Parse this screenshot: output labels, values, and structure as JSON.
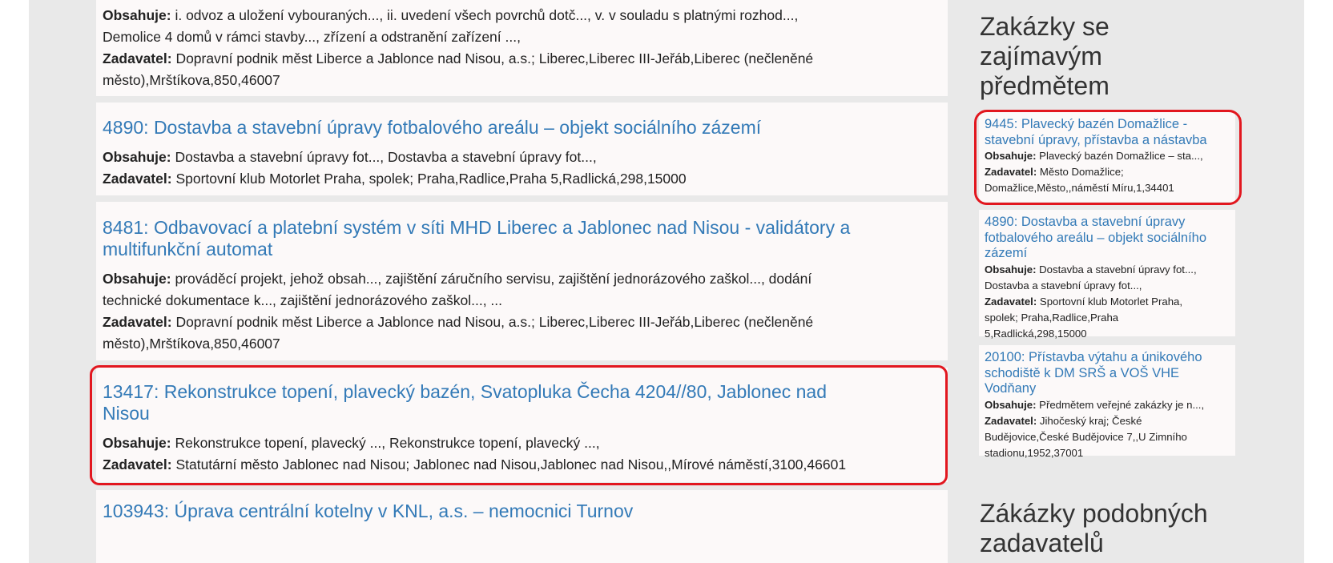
{
  "labels": {
    "obsahuje": "Obsahuje:",
    "zadavatel": "Zadavatel:"
  },
  "main": {
    "cards": [
      {
        "title": "",
        "obsahuje_lines": [
          "i. odvoz a uložení vybouraných..., ii. uvedení všech povrchů dotč..., v. v souladu s platnými rozhod...,",
          "Demolice 4 domů v rámci stavby..., zřízení a odstranění zařízení ...,"
        ],
        "zadavatel_lines": [
          "Dopravní podnik měst Liberce a Jablonce nad Nisou, a.s.; Liberec,Liberec III-Jeřáb,Liberec (nečleněné",
          "město),Mrštíkova,850,46007"
        ]
      },
      {
        "title": "4890: Dostavba a stavební úpravy fotbalového areálu – objekt sociálního zázemí",
        "obsahuje_lines": [
          "Dostavba a stavební úpravy fot..., Dostavba a stavební úpravy fot...,"
        ],
        "zadavatel_lines": [
          "Sportovní klub Motorlet Praha, spolek; Praha,Radlice,Praha 5,Radlická,298,15000"
        ]
      },
      {
        "title_lines": [
          "8481: Odbavovací a platební systém v síti MHD Liberec a Jablonec nad Nisou - validátory a",
          "multifunkční automat"
        ],
        "obsahuje_lines": [
          "prováděcí projekt, jehož obsah..., zajištění záručního servisu, zajištění jednorázového zaškol..., dodání",
          "technické dokumentace k..., zajištění jednorázového zaškol..., ..."
        ],
        "zadavatel_lines": [
          "Dopravní podnik měst Liberce a Jablonce nad Nisou, a.s.; Liberec,Liberec III-Jeřáb,Liberec (nečleněné",
          "město),Mrštíkova,850,46007"
        ]
      },
      {
        "title_lines": [
          "13417: Rekonstrukce topení, plavecký bazén, Svatopluka Čecha 4204//80, Jablonec nad",
          "Nisou"
        ],
        "obsahuje_lines": [
          "Rekonstrukce topení, plavecký ..., Rekonstrukce topení, plavecký ...,"
        ],
        "zadavatel_lines": [
          "Statutární město Jablonec nad Nisou; Jablonec nad Nisou,Jablonec nad Nisou,,Mírové náměstí,3100,46601"
        ]
      },
      {
        "title": "103943: Úprava centrální kotelny v KNL, a.s. – nemocnici Turnov"
      }
    ]
  },
  "sidebar": {
    "heading1_lines": [
      "Zakázky se",
      "zajímavým",
      "předmětem"
    ],
    "heading2_lines": [
      "Zákázky podobných",
      "zadavatelů"
    ],
    "cards": [
      {
        "title_lines": [
          "9445: Plavecký bazén Domažlice -",
          "stavební úpravy, přístavba a nástavba"
        ],
        "obsahuje": "Plavecký bazén Domažlice – sta...,",
        "zadavatel_lines": [
          "Město Domažlice;",
          "Domažlice,Město,,náměstí Míru,1,34401"
        ]
      },
      {
        "title_lines": [
          "4890: Dostavba a stavební úpravy",
          "fotbalového areálu – objekt sociálního",
          "zázemí"
        ],
        "obsahuje_lines": [
          "Dostavba a stavební úpravy fot...,",
          "Dostavba a stavební úpravy fot...,"
        ],
        "zadavatel_lines": [
          "Sportovní klub Motorlet Praha,",
          "spolek; Praha,Radlice,Praha",
          "5,Radlická,298,15000"
        ]
      },
      {
        "title_lines": [
          "20100: Přístavba výtahu a únikového",
          "schodiště k DM SRŠ a VOŠ VHE",
          "Vodňany"
        ],
        "obsahuje": "Předmětem veřejné zakázky je n...,",
        "zadavatel_lines": [
          "Jihočeský kraj; České",
          "Budějovice,České Budějovice 7,,U Zimního",
          "stadionu,1952,37001"
        ]
      }
    ]
  },
  "colors": {
    "link": "#337ab7",
    "highlight": "#e2171f",
    "card_bg": "#fcf9f9",
    "page_bg": "#e9e9e9"
  }
}
